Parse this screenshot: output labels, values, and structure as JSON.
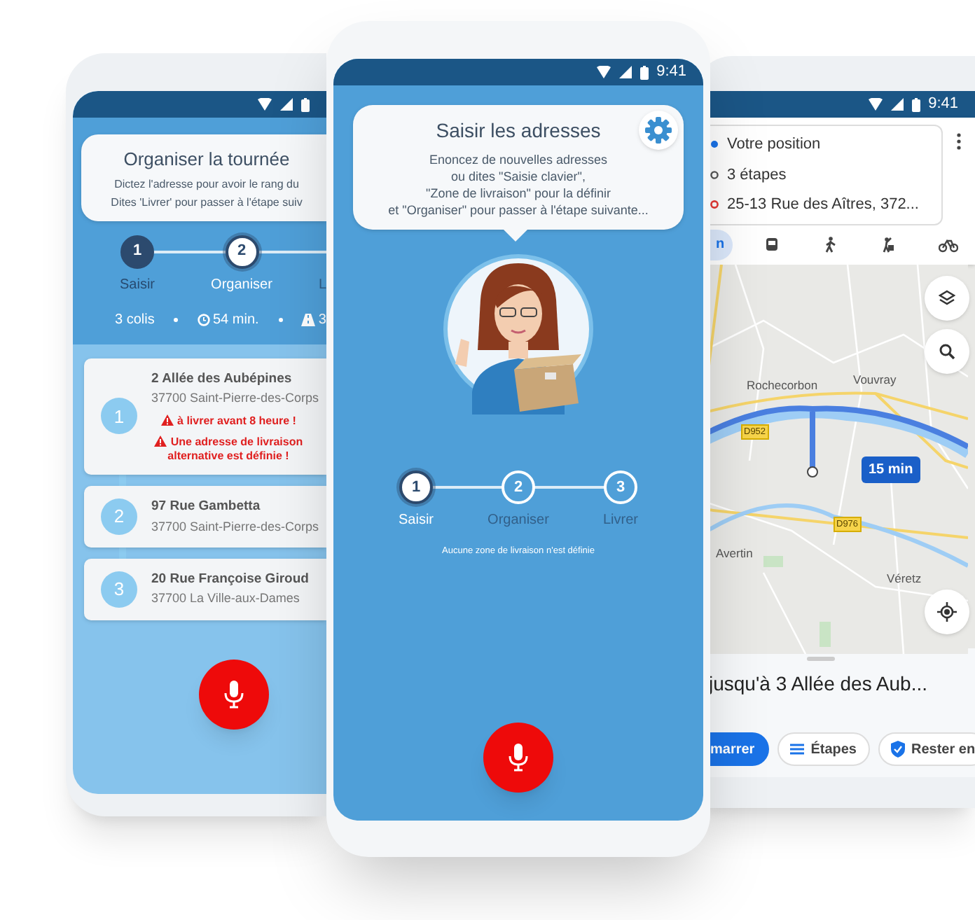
{
  "left_phone": {
    "card": {
      "title": "Organiser la tournée",
      "lines": [
        "Dictez l'adresse pour avoir le rang du",
        "Dites 'Livrer' pour passer à l'étape suiv"
      ]
    },
    "steps": [
      {
        "number": "1",
        "label": "Saisir",
        "completed": true,
        "selected": false
      },
      {
        "number": "2",
        "label": "Organiser",
        "completed": false,
        "selected": true
      },
      {
        "label": "L",
        "completed": false,
        "selected": false
      }
    ],
    "stats": [
      {
        "kind": "parcels",
        "text": "3 colis"
      },
      {
        "kind": "duration",
        "text": "54 min."
      },
      {
        "kind": "distance",
        "text": "3"
      }
    ],
    "stops": [
      {
        "number": "1",
        "street": "2 Allée des Aubépines",
        "city": "37700 Saint-Pierre-des-Corps",
        "warnings": [
          "à livrer avant 8 heure !",
          "Une adresse de livraison alternative est définie !"
        ]
      },
      {
        "number": "2",
        "street": "97 Rue Gambetta",
        "city": "37700 Saint-Pierre-des-Corps"
      },
      {
        "number": "3",
        "street": "20 Rue Françoise Giroud",
        "city": "37700 La Ville-aux-Dames"
      }
    ]
  },
  "center_phone": {
    "time": "9:41",
    "card": {
      "title": "Saisir les adresses",
      "lines": [
        "Enoncez de nouvelles adresses",
        "ou dites \"Saisie clavier\",",
        "\"Zone de livraison\" pour la définir",
        "et \"Organiser\" pour passer à l'étape suivante..."
      ]
    },
    "steps": [
      {
        "number": "1",
        "label": "Saisir",
        "completed": false,
        "selected": true
      },
      {
        "number": "2",
        "label": "Organiser",
        "completed": false,
        "selected": false
      },
      {
        "number": "3",
        "label": "Livrer",
        "completed": false,
        "selected": false
      }
    ],
    "zone_note": "Aucune zone de livraison n'est définie"
  },
  "right_phone": {
    "time": "9:41",
    "route": [
      {
        "kind": "origin",
        "text": "Votre position"
      },
      {
        "kind": "stops",
        "text": "3 étapes"
      },
      {
        "kind": "destination",
        "text": "25-13 Rue des Aîtres, 372..."
      }
    ],
    "modes": [
      {
        "kind": "car",
        "label": "n",
        "selected": true
      },
      {
        "kind": "transit",
        "selected": false
      },
      {
        "kind": "walk",
        "selected": false
      },
      {
        "kind": "ride",
        "selected": false
      },
      {
        "kind": "bike",
        "selected": false
      }
    ],
    "map_labels": [
      {
        "kind": "place",
        "text": "Rochecorbon"
      },
      {
        "kind": "place",
        "text": "Vouvray"
      },
      {
        "kind": "road",
        "text": "D952"
      },
      {
        "kind": "place",
        "text": "Avertin"
      },
      {
        "kind": "road",
        "text": "D976"
      },
      {
        "kind": "place",
        "text": "Véretz"
      }
    ],
    "duration_badge": "15 min",
    "summary": "jusqu'à 3 Allée des Aub...",
    "actions": [
      {
        "kind": "start",
        "label": "marrer"
      },
      {
        "kind": "steps",
        "label": "Étapes"
      },
      {
        "kind": "stay",
        "label": "Rester en"
      }
    ]
  }
}
